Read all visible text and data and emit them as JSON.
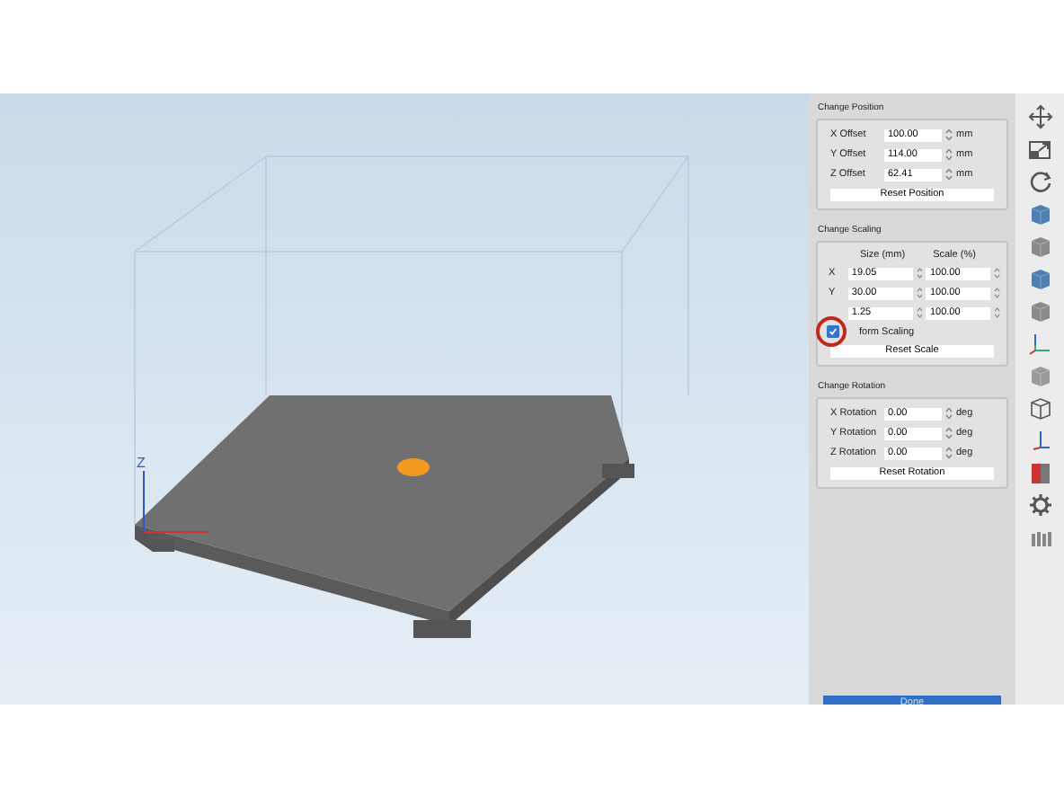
{
  "viewport": {
    "axis_label": "Z"
  },
  "position": {
    "title": "Change Position",
    "rows": [
      {
        "label": "X Offset",
        "value": "100.00",
        "unit": "mm"
      },
      {
        "label": "Y Offset",
        "value": "114.00",
        "unit": "mm"
      },
      {
        "label": "Z Offset",
        "value": "62.41",
        "unit": "mm"
      }
    ],
    "button": "Reset Position"
  },
  "scaling": {
    "title": "Change Scaling",
    "headers": [
      "Size (mm)",
      "Scale (%)"
    ],
    "rows": [
      {
        "axis": "X",
        "size": "19.05",
        "scale": "100.00"
      },
      {
        "axis": "Y",
        "size": "30.00",
        "scale": "100.00"
      },
      {
        "axis": "",
        "size": "1.25",
        "scale": "100.00"
      }
    ],
    "checkbox": {
      "label": "form Scaling",
      "checked": true
    },
    "button": "Reset Scale"
  },
  "rotation": {
    "title": "Change Rotation",
    "rows": [
      {
        "label": "X Rotation",
        "value": "0.00",
        "unit": "deg"
      },
      {
        "label": "Y Rotation",
        "value": "0.00",
        "unit": "deg"
      },
      {
        "label": "Z Rotation",
        "value": "0.00",
        "unit": "deg"
      }
    ],
    "button": "Reset Rotation"
  },
  "done_button": "Done"
}
